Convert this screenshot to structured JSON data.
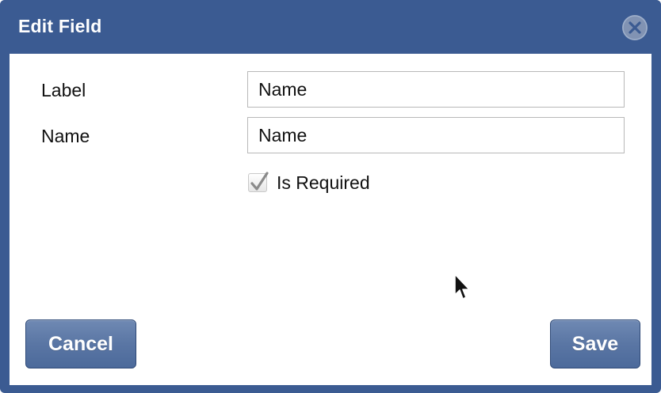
{
  "dialog": {
    "title": "Edit Field",
    "close_icon": "close-circle-icon"
  },
  "form": {
    "label_field": {
      "label": "Label",
      "value": "Name"
    },
    "name_field": {
      "label": "Name",
      "value": "Name"
    },
    "required_checkbox": {
      "label": "Is Required",
      "checked": true,
      "icon": "checkmark-icon"
    }
  },
  "buttons": {
    "cancel_label": "Cancel",
    "save_label": "Save"
  },
  "colors": {
    "titlebar": "#3b5b92",
    "button": "#5a76a4",
    "close_button": "#8193b3"
  },
  "cursor_icon": "mouse-pointer-icon"
}
